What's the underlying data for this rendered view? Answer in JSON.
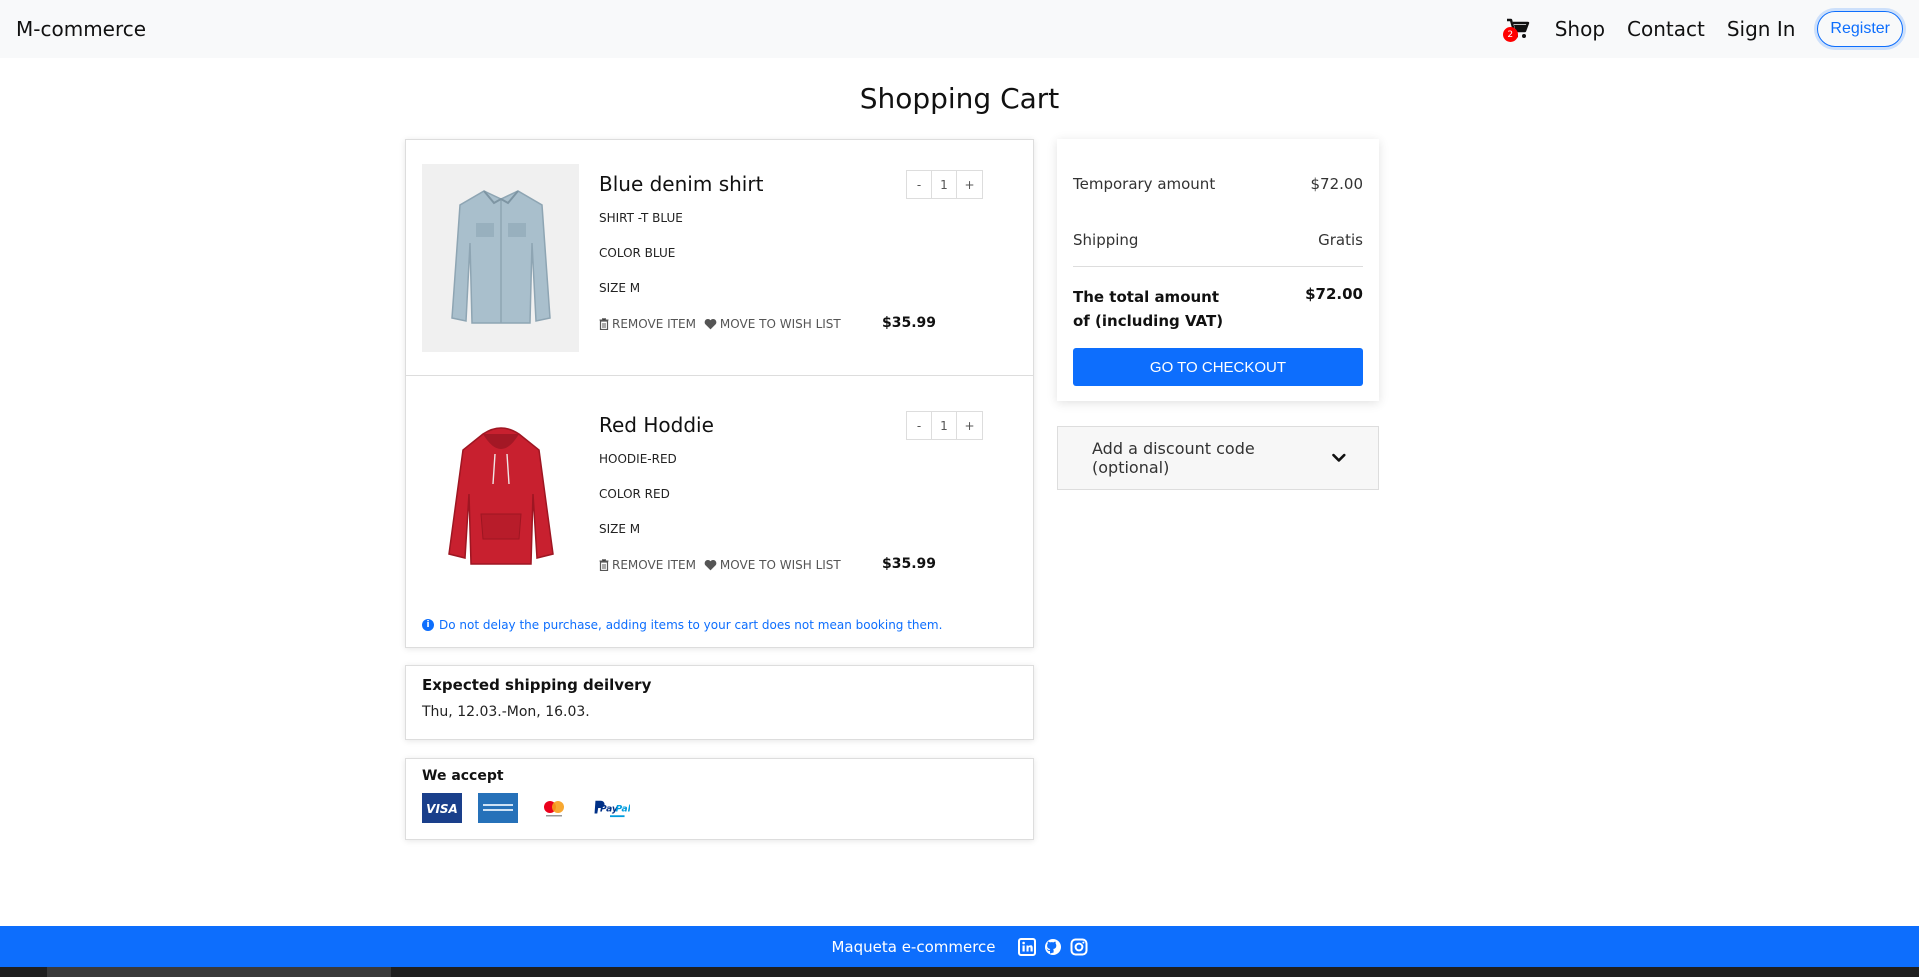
{
  "navbar": {
    "brand": "M-commerce",
    "cart_count": "2",
    "links": [
      "Shop",
      "Contact",
      "Sign In"
    ],
    "register": "Register"
  },
  "page": {
    "title": "Shopping Cart"
  },
  "cart": {
    "items": [
      {
        "name": "Blue denim shirt",
        "sku": "SHIRT -T BLUE",
        "color": "COLOR BLUE",
        "size": "SIZE M",
        "qty_minus": "-",
        "qty": "1",
        "qty_plus": "+",
        "remove": "REMOVE ITEM",
        "wishlist": "MOVE TO WISH LIST",
        "price": "$35.99"
      },
      {
        "name": "Red Hoddie",
        "sku": "HOODIE-RED",
        "color": "COLOR RED",
        "size": "SIZE M",
        "qty_minus": "-",
        "qty": "1",
        "qty_plus": "+",
        "remove": "REMOVE ITEM",
        "wishlist": "MOVE TO WISH LIST",
        "price": "$35.99"
      }
    ],
    "notice": "Do not delay the purchase, adding items to your cart does not mean booking them."
  },
  "shipping": {
    "title": "Expected shipping deilvery",
    "dates": "Thu, 12.03.-Mon, 16.03."
  },
  "payment": {
    "title": "We accept",
    "logos": [
      "visa-logo",
      "amex-logo",
      "mastercard-logo",
      "paypal-logo"
    ]
  },
  "summary": {
    "temp_label": "Temporary amount",
    "temp_value": "$72.00",
    "shipping_label": "Shipping",
    "shipping_value": "Gratis",
    "total_label": "The total amount of (including VAT)",
    "total_value": "$72.00",
    "checkout": "GO TO CHECKOUT"
  },
  "discount": {
    "label": "Add a discount code (optional)"
  },
  "footer": {
    "text": "Maqueta e-commerce",
    "icons": [
      "linkedin-icon",
      "github-icon",
      "instagram-icon"
    ]
  },
  "colors": {
    "primary": "#0d6efd",
    "badge": "#ff0000",
    "navbar_bg": "#f8f9fa"
  }
}
